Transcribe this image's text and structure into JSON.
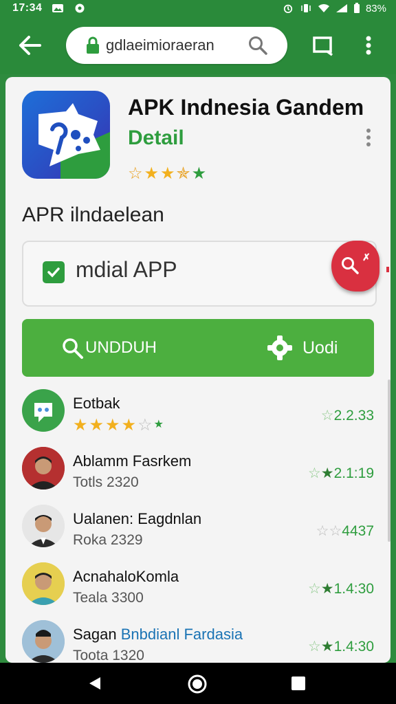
{
  "status_bar": {
    "time": "17:34",
    "battery": "83%"
  },
  "toolbar": {
    "url": "gdlaeimioraeran",
    "icons": [
      "back-arrow-icon",
      "lock-icon",
      "search-icon",
      "tab-icon",
      "more-vert-icon"
    ]
  },
  "app": {
    "title": "APK Indnesia Gandem",
    "subtitle": "Detail",
    "rating_stars": 4
  },
  "section": {
    "title": "APR ilndaelean"
  },
  "filter": {
    "label": "mdial APP",
    "checked": true
  },
  "actions": {
    "download_label": "UNDDUH",
    "update_label": "Uodi"
  },
  "list": {
    "items": [
      {
        "title": "Eotbak",
        "subtitle": "",
        "rating": "2.2.33",
        "stars": 3.5
      },
      {
        "title": "Ablamm Fasrkem",
        "subtitle": "Totls 2320",
        "rating": "2.1:19"
      },
      {
        "title": "Ualanen: Eagdnlan",
        "subtitle": "Roka 2329",
        "rating": "4437"
      },
      {
        "title": "AcnahaloKomla",
        "subtitle": "Teala 3300",
        "rating": "1.4:30"
      },
      {
        "title_a": "Sagan",
        "title_b": "Bnbdianl Fardasia",
        "subtitle": "Toota 1320",
        "rating": "1.4:30"
      }
    ]
  },
  "colors": {
    "primary": "#2a8a3a",
    "accent_green": "#4caf3f",
    "fab_red": "#d93040",
    "star_yellow": "#f2b01e"
  }
}
